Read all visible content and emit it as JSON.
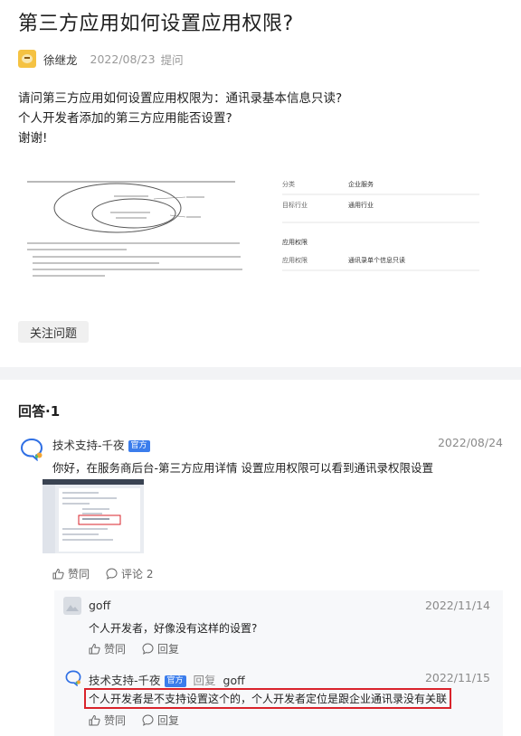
{
  "question": {
    "title": "第三方应用如何设置应用权限?",
    "author": "徐继龙",
    "date": "2022/08/23",
    "action": "提问",
    "body": [
      "请问第三方应用如何设置应用权限为：通讯录基本信息只读?",
      "个人开发者添加的第三方应用能否设置?",
      "谢谢!"
    ],
    "follow_label": "关注问题",
    "image_form": {
      "rows": [
        {
          "label": "分类",
          "value": "企业服务"
        },
        {
          "label": "目标行业",
          "value": "通用行业"
        }
      ],
      "section_label": "应用权限",
      "perm_row": {
        "label": "应用权限",
        "value": "通讯录单个信息只读"
      }
    }
  },
  "answers": {
    "heading": "回答·1",
    "items": [
      {
        "name": "技术支持-千夜",
        "badge": "官方",
        "date": "2022/08/24",
        "text": "你好，在服务商后台-第三方应用详情 设置应用权限可以看到通讯录权限设置",
        "like_label": "赞同",
        "comment_label": "评论 2",
        "replies": [
          {
            "name": "goff",
            "date": "2022/11/14",
            "text": "个人开发者，好像没有这样的设置?",
            "like_label": "赞同",
            "reply_label": "回复"
          },
          {
            "name": "技术支持-千夜",
            "badge": "官方",
            "reply_word": "回复",
            "reply_to": "goff",
            "date": "2022/11/15",
            "text": "个人开发者是不支持设置这个的，个人开发者定位是跟企业通讯录没有关联",
            "like_label": "赞同",
            "reply_label": "回复"
          }
        ]
      }
    ]
  },
  "colors": {
    "accent": "#3b7dec",
    "highlight_border": "#d9232b",
    "page_bg": "#f2f3f5"
  },
  "icons": [
    "thumbs-up-icon",
    "comment-icon",
    "service-chat-icon"
  ]
}
